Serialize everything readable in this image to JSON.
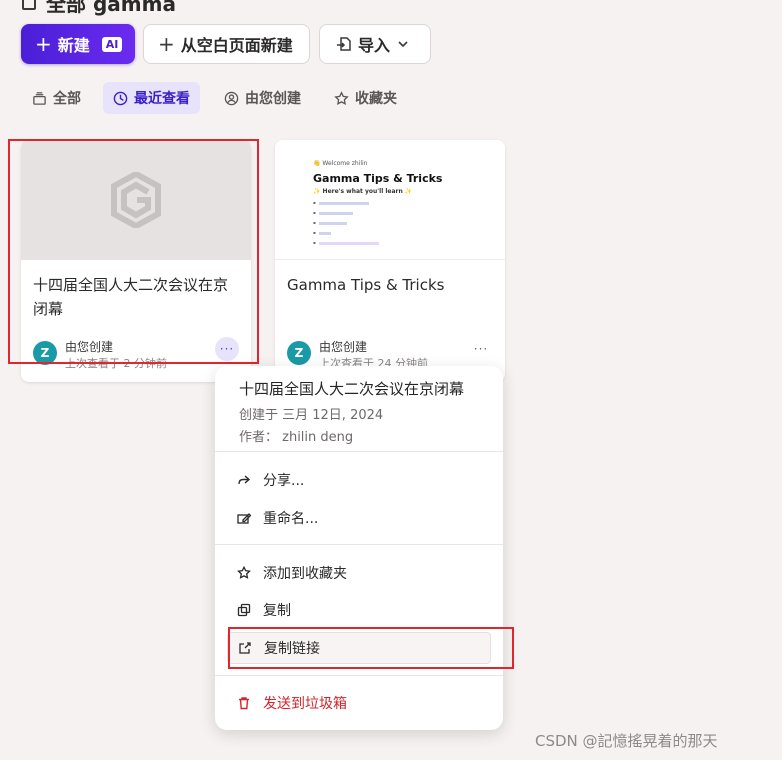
{
  "header": {
    "title": "全部 gamma"
  },
  "toolbar": {
    "new_label": "新建",
    "ai_badge": "AI",
    "blank_label": "从空白页面新建",
    "import_label": "导入"
  },
  "tabs": [
    {
      "label": "全部",
      "icon": "stack-icon",
      "active": false
    },
    {
      "label": "最近查看",
      "icon": "clock-icon",
      "active": true
    },
    {
      "label": "由您创建",
      "icon": "user-circle-icon",
      "active": false
    },
    {
      "label": "收藏夹",
      "icon": "star-icon",
      "active": false
    }
  ],
  "cards": [
    {
      "title": "十四届全国人大二次会议在京闭幕",
      "creator": "由您创建",
      "viewed": "上次查看于 2 分钟前",
      "avatar": "Z"
    },
    {
      "title": "Gamma Tips & Tricks",
      "creator": "由您创建",
      "viewed": "上次查看于 24 分钟前",
      "avatar": "Z",
      "thumb": {
        "hello": "👋 Welcome zhilin",
        "heading": "Gamma Tips & Tricks",
        "sub": "✨ Here's what you'll learn ✨"
      }
    }
  ],
  "menu": {
    "title": "十四届全国人大二次会议在京闭幕",
    "created": "创建于 三月 12日, 2024",
    "author": "作者： zhilin deng",
    "items": {
      "share": "分享...",
      "rename": "重命名...",
      "favorite": "添加到收藏夹",
      "duplicate": "复制",
      "copy_link": "复制链接",
      "trash": "发送到垃圾箱"
    }
  },
  "watermark": "CSDN @記憶搖晃着的那天",
  "colors": {
    "accent": "#4a1fd6",
    "danger": "#d8232a",
    "highlight": "#e0262e",
    "avatar": "#1a9aa7"
  }
}
